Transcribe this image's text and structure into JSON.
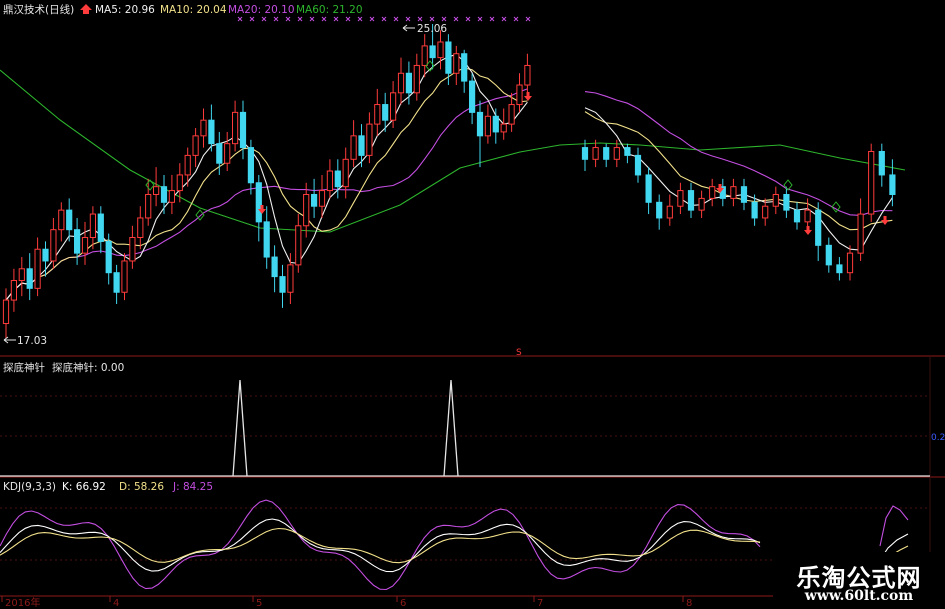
{
  "colors": {
    "background": "#000000",
    "up": "#ff3b3b",
    "down": "#41d7f0",
    "ma5": "#f0f0f0",
    "ma10": "#f1e08a",
    "ma20": "#c34ee0",
    "ma60": "#2db52d",
    "kdj_k": "#ffffff",
    "kdj_d": "#f1e08a",
    "kdj_j": "#c34ee0",
    "panel_sep": "#8e1a1a",
    "signal_line": "#e6e6e6"
  },
  "main_panel": {
    "title": "鼎汉技术(日线)",
    "ma5_label": "MA5: 20.96",
    "ma10_label": "MA10: 20.04",
    "ma20_label": "MA20: 20.10",
    "ma60_label": "MA60: 21.20",
    "high_label": "25.06",
    "low_label": "17.03"
  },
  "indicator_panel": {
    "title": "探底神针",
    "value_label": "探底神针: 0.00",
    "right_scale_label": "0.2"
  },
  "kdj_panel": {
    "title": "KDJ(9,3,3)",
    "k_label": "K: 66.92",
    "d_label": "D: 58.26",
    "j_label": "J: 84.25"
  },
  "x_axis": {
    "labels": [
      "2016年",
      "4",
      "5",
      "6",
      "7",
      "8"
    ]
  },
  "watermark": {
    "name": "乐淘公式网",
    "url": "www.60lt.com"
  },
  "chart_data": [
    {
      "type": "candlestick",
      "title": "鼎汉技术(日线)",
      "price_range": [
        17.03,
        25.06
      ],
      "series": [
        {
          "name": "MA5",
          "last": 20.96
        },
        {
          "name": "MA10",
          "last": 20.04
        },
        {
          "name": "MA20",
          "last": 20.1
        },
        {
          "name": "MA60",
          "last": 21.2
        }
      ],
      "candles": [
        [
          17.4,
          18.0,
          17.03,
          18.3
        ],
        [
          18.0,
          18.5,
          17.7,
          18.8
        ],
        [
          18.5,
          18.8,
          18.1,
          19.1
        ],
        [
          18.8,
          18.3,
          18.0,
          19.2
        ],
        [
          18.3,
          19.3,
          18.1,
          19.6
        ],
        [
          19.3,
          19.0,
          18.6,
          19.5
        ],
        [
          19.0,
          19.8,
          18.8,
          20.1
        ],
        [
          19.8,
          20.3,
          19.5,
          20.5
        ],
        [
          20.3,
          19.8,
          19.5,
          20.6
        ],
        [
          19.8,
          19.2,
          18.9,
          20.1
        ],
        [
          19.2,
          19.6,
          18.9,
          20.0
        ],
        [
          19.6,
          20.2,
          19.3,
          20.4
        ],
        [
          20.2,
          19.5,
          19.2,
          20.4
        ],
        [
          19.5,
          18.7,
          18.4,
          19.7
        ],
        [
          18.7,
          18.2,
          17.9,
          18.9
        ],
        [
          18.2,
          19.0,
          18.0,
          19.2
        ],
        [
          19.0,
          19.6,
          18.8,
          19.9
        ],
        [
          19.6,
          20.1,
          19.3,
          20.4
        ],
        [
          20.1,
          20.7,
          19.9,
          21.1
        ],
        [
          20.7,
          20.9,
          20.4,
          21.4
        ],
        [
          20.9,
          20.5,
          20.2,
          21.2
        ],
        [
          20.5,
          20.8,
          20.2,
          21.2
        ],
        [
          20.8,
          21.2,
          20.5,
          21.5
        ],
        [
          21.2,
          21.7,
          20.9,
          21.9
        ],
        [
          21.7,
          22.2,
          21.4,
          22.4
        ],
        [
          22.2,
          22.6,
          21.9,
          22.9
        ],
        [
          22.6,
          22.0,
          21.8,
          23.0
        ],
        [
          22.0,
          21.5,
          21.2,
          22.3
        ],
        [
          21.5,
          22.0,
          21.3,
          22.3
        ],
        [
          22.0,
          22.8,
          21.8,
          23.1
        ],
        [
          22.8,
          21.9,
          21.6,
          23.1
        ],
        [
          21.9,
          21.0,
          20.7,
          22.1
        ],
        [
          21.0,
          20.0,
          19.5,
          21.2
        ],
        [
          20.0,
          19.1,
          18.8,
          20.4
        ],
        [
          19.1,
          18.6,
          18.2,
          19.4
        ],
        [
          18.6,
          18.2,
          17.8,
          18.9
        ],
        [
          18.2,
          18.9,
          17.9,
          19.2
        ],
        [
          18.9,
          19.9,
          18.7,
          20.2
        ],
        [
          19.9,
          20.7,
          19.6,
          21.0
        ],
        [
          20.7,
          20.4,
          20.1,
          21.1
        ],
        [
          20.4,
          20.8,
          20.1,
          21.2
        ],
        [
          20.8,
          21.3,
          20.6,
          21.6
        ],
        [
          21.3,
          20.9,
          20.6,
          21.6
        ],
        [
          20.9,
          21.6,
          20.6,
          21.9
        ],
        [
          21.6,
          22.2,
          21.4,
          22.6
        ],
        [
          22.2,
          21.7,
          21.4,
          22.5
        ],
        [
          21.7,
          22.5,
          21.5,
          22.8
        ],
        [
          22.5,
          23.0,
          22.2,
          23.4
        ],
        [
          23.0,
          22.6,
          22.3,
          23.3
        ],
        [
          22.6,
          23.3,
          22.4,
          23.6
        ],
        [
          23.3,
          23.8,
          23.0,
          24.2
        ],
        [
          23.8,
          23.3,
          23.0,
          24.1
        ],
        [
          23.3,
          24.0,
          23.1,
          24.3
        ],
        [
          24.0,
          24.5,
          23.7,
          24.8
        ],
        [
          24.5,
          24.2,
          23.9,
          25.06
        ],
        [
          24.2,
          24.6,
          23.9,
          24.9
        ],
        [
          24.6,
          23.8,
          23.5,
          24.8
        ],
        [
          23.8,
          24.3,
          23.5,
          24.5
        ],
        [
          24.3,
          23.6,
          23.3,
          24.4
        ],
        [
          23.6,
          22.8,
          22.5,
          23.8
        ],
        [
          22.8,
          22.2,
          21.4,
          23.1
        ],
        [
          22.2,
          22.7,
          22.0,
          23.0
        ],
        [
          22.7,
          22.3,
          22.0,
          22.9
        ],
        [
          22.3,
          22.5,
          22.1,
          22.9
        ],
        [
          22.5,
          23.0,
          22.3,
          23.3
        ],
        [
          23.0,
          23.5,
          22.8,
          23.8
        ],
        [
          23.5,
          24.0,
          23.3,
          24.3
        ]
      ],
      "candles_after_gap": [
        [
          21.9,
          21.6,
          21.3,
          22.1
        ],
        [
          21.6,
          21.9,
          21.4,
          22.1
        ],
        [
          21.9,
          21.6,
          21.4,
          22.0
        ],
        [
          21.6,
          21.9,
          21.4,
          22.1
        ],
        [
          21.9,
          21.7,
          21.5,
          22.0
        ],
        [
          21.7,
          21.2,
          21.0,
          21.9
        ],
        [
          21.2,
          20.5,
          20.2,
          21.4
        ],
        [
          20.5,
          20.1,
          19.8,
          20.7
        ],
        [
          20.1,
          20.4,
          19.9,
          20.7
        ],
        [
          20.4,
          20.8,
          20.2,
          21.0
        ],
        [
          20.8,
          20.3,
          20.1,
          21.0
        ],
        [
          20.3,
          20.6,
          20.1,
          20.8
        ],
        [
          20.6,
          20.9,
          20.4,
          21.1
        ],
        [
          20.9,
          20.6,
          20.4,
          21.1
        ],
        [
          20.6,
          20.9,
          20.4,
          21.1
        ],
        [
          20.9,
          20.5,
          20.3,
          21.1
        ],
        [
          20.5,
          20.1,
          19.9,
          20.7
        ],
        [
          20.1,
          20.4,
          19.9,
          20.6
        ],
        [
          20.4,
          20.7,
          20.2,
          20.9
        ],
        [
          20.7,
          20.3,
          20.1,
          20.9
        ],
        [
          20.3,
          20.0,
          19.8,
          20.5
        ],
        [
          20.0,
          20.3,
          19.8,
          20.6
        ],
        [
          20.3,
          19.4,
          19.0,
          20.5
        ],
        [
          19.4,
          18.9,
          18.7,
          19.6
        ],
        [
          18.9,
          18.7,
          18.5,
          19.1
        ],
        [
          18.7,
          19.2,
          18.5,
          19.4
        ],
        [
          19.2,
          20.2,
          19.0,
          20.6
        ],
        [
          20.2,
          21.8,
          20.0,
          22.0
        ],
        [
          21.8,
          21.2,
          20.9,
          22.0
        ],
        [
          21.2,
          20.7,
          20.4,
          21.6
        ]
      ]
    },
    {
      "type": "line",
      "title": "探底神针",
      "value": 0.0,
      "spikes": [
        {
          "value": 0.2
        },
        {
          "value": 0.2
        }
      ]
    },
    {
      "type": "line",
      "title": "KDJ(9,3,3)",
      "series": [
        {
          "name": "K",
          "last": 66.92
        },
        {
          "name": "D",
          "last": 58.26
        },
        {
          "name": "J",
          "last": 84.25
        }
      ]
    }
  ]
}
